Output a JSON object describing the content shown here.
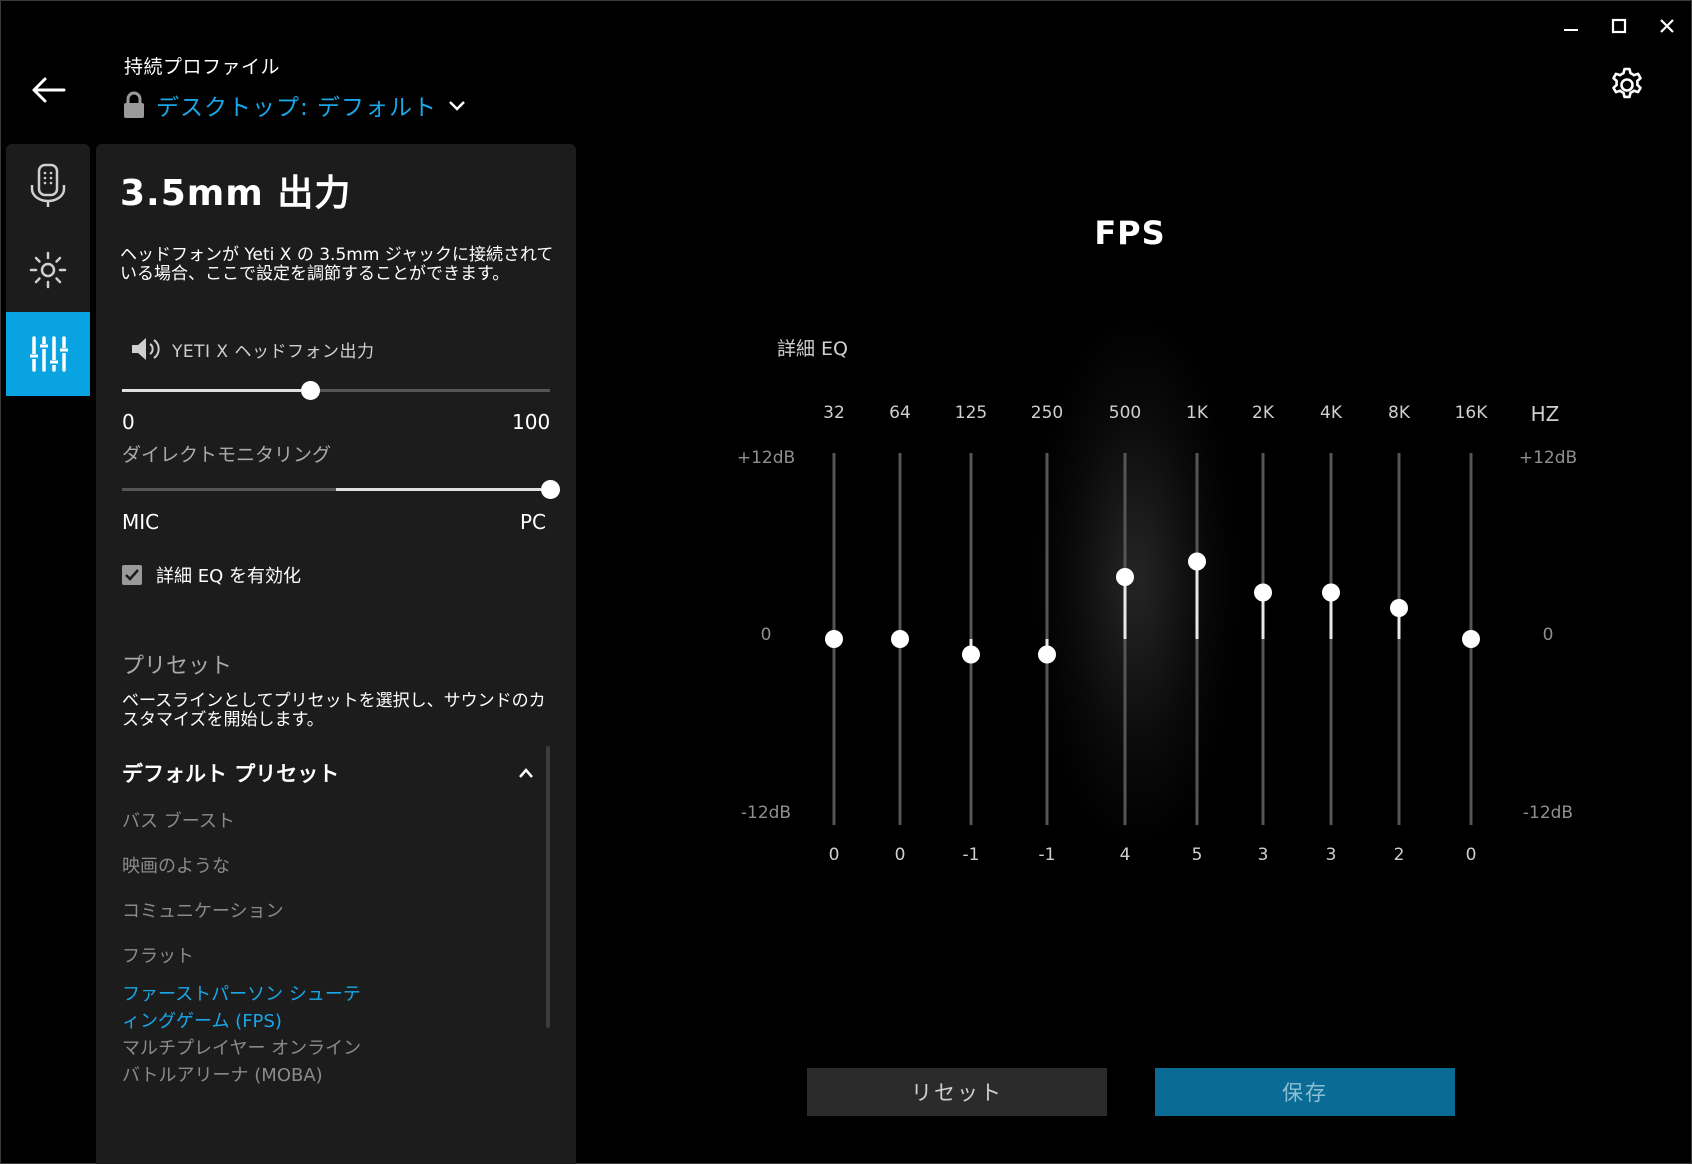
{
  "header": {
    "profile_caption": "持続プロファイル",
    "profile_name": "デスクトップ: デフォルト"
  },
  "panel": {
    "title": "3.5mm 出力",
    "description": "ヘッドフォンが Yeti X の 3.5mm ジャックに接続されている場合、ここで設定を調節することができます。",
    "output_label": "YETI X ヘッドフォン出力",
    "volume": {
      "value": 44,
      "min_label": "0",
      "max_label": "100"
    },
    "monitoring": {
      "heading": "ダイレクトモニタリング",
      "value": 100,
      "fill_start": 50,
      "min_label": "MIC",
      "max_label": "PC"
    },
    "advanced_eq_checkbox": {
      "label": "詳細 EQ を有効化",
      "checked": true
    },
    "preset_heading": "プリセット",
    "preset_description": "ベースラインとしてプリセットを選択し、サウンドのカスタマイズを開始します。",
    "preset_group_title": "デフォルト プリセット",
    "presets": [
      {
        "label": "バス ブースト",
        "selected": false
      },
      {
        "label": "映画のような",
        "selected": false
      },
      {
        "label": "コミュニケーション",
        "selected": false
      },
      {
        "label": "フラット",
        "selected": false
      },
      {
        "label": "ファーストパーソン シューティングゲーム (FPS)",
        "selected": true
      },
      {
        "label": "マルチプレイヤー オンライン バトルアリーナ (MOBA)",
        "selected": false
      }
    ]
  },
  "eq": {
    "title": "FPS",
    "heading": "詳細 EQ",
    "unit_label": "HZ",
    "top_label": "+12dB",
    "mid_label": "0",
    "bottom_label": "-12dB",
    "range": [
      -12,
      12
    ],
    "bands": [
      {
        "freq": "32",
        "gain": 0
      },
      {
        "freq": "64",
        "gain": 0
      },
      {
        "freq": "125",
        "gain": -1
      },
      {
        "freq": "250",
        "gain": -1
      },
      {
        "freq": "500",
        "gain": 4
      },
      {
        "freq": "1K",
        "gain": 5
      },
      {
        "freq": "2K",
        "gain": 3
      },
      {
        "freq": "4K",
        "gain": 3
      },
      {
        "freq": "8K",
        "gain": 2
      },
      {
        "freq": "16K",
        "gain": 0
      }
    ]
  },
  "buttons": {
    "reset": "リセット",
    "save": "保存"
  },
  "colors": {
    "accent": "#1aa7e8",
    "rail_active": "#0aa3e2",
    "save_bg": "#0a6b94",
    "panel_bg": "#1c1c1c"
  },
  "icons": {
    "back": "arrow-left-icon",
    "lock": "lock-icon",
    "dropdown": "chevron-down-icon",
    "settings": "gear-icon",
    "rail": [
      "microphone-icon",
      "brightness-icon",
      "equalizer-icon"
    ],
    "speaker": "speaker-icon",
    "collapse": "chevron-up-icon"
  }
}
